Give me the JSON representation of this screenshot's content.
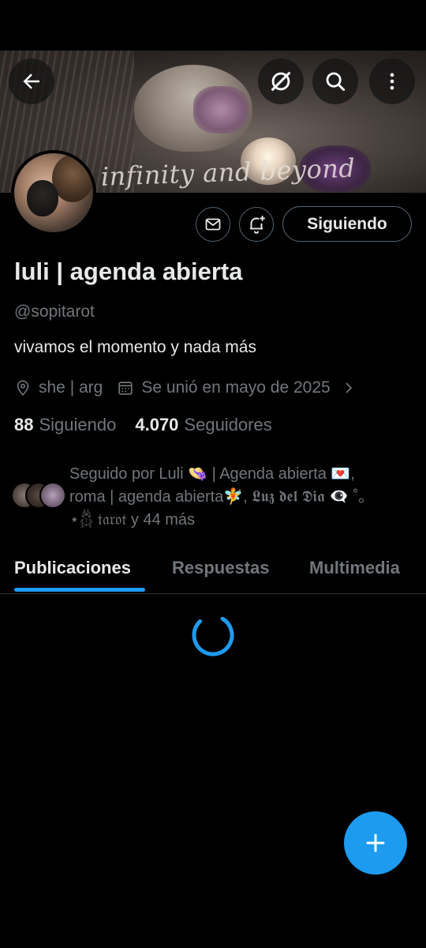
{
  "banner": {
    "caption": "To infinity and beyond"
  },
  "header": {
    "back_icon": "arrow-left-icon",
    "grok_icon": "grok-icon",
    "search_icon": "search-icon",
    "more_icon": "more-vertical-icon"
  },
  "actions": {
    "message_icon": "mail-icon",
    "notify_icon": "bell-plus-icon",
    "following_label": "Siguiendo"
  },
  "profile": {
    "name": "luli | agenda abierta",
    "handle": "@sopitarot",
    "bio": "vivamos el momento y nada más",
    "location": "she | arg",
    "joined": "Se unió en mayo de 2025",
    "following_count": "88",
    "following_label": "Siguiendo",
    "followers_count": "4.070",
    "followers_label": "Seguidores"
  },
  "followed_by": {
    "line1": "Seguido por Luli 👒 | Agenda abierta 💌,",
    "line2": "roma | agenda abierta🧚, 𝕷𝖚𝖟 𝖉𝖊𝖑 𝕯𝖎𝖆 👁️‍🗨️ ˚｡",
    "line3_prefix": "⋆𓆣 𝔱𝔞𝔯𝔬𝔱",
    "line3_suffix": " y 44 más"
  },
  "tabs": [
    {
      "label": "Publicaciones",
      "active": true
    },
    {
      "label": "Respuestas",
      "active": false
    },
    {
      "label": "Multimedia",
      "active": false
    }
  ],
  "colors": {
    "accent": "#1d9bf0",
    "muted": "#71767b",
    "text": "#e7e9ea",
    "border": "#536471"
  },
  "fab": {
    "icon": "plus-icon"
  }
}
